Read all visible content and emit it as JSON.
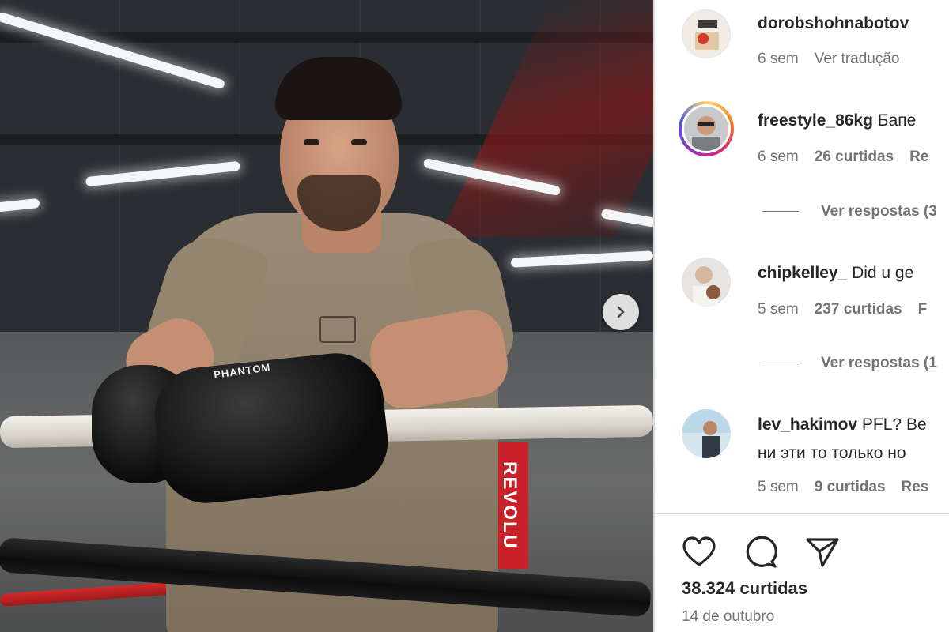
{
  "post": {
    "next_icon": "chevron-right-icon",
    "glove_brand": "PHANTOM",
    "banner_text": "REVOLU"
  },
  "comments": [
    {
      "username": "dorobshohnabotov",
      "text": "",
      "time": "6 sem",
      "likes": "",
      "action": "Ver tradução",
      "replies": ""
    },
    {
      "username": "freestyle_86kg",
      "text": "Бапе",
      "time": "6 sem",
      "likes": "26 curtidas",
      "action": "Re",
      "replies": "Ver respostas (3"
    },
    {
      "username": "chipkelley_",
      "text": "Did u ge",
      "time": "5 sem",
      "likes": "237 curtidas",
      "action": "F",
      "replies": "Ver respostas (1"
    },
    {
      "username": "lev_hakimov",
      "text": "PFL? Be",
      "text2": "ни эти то только но",
      "time": "5 sem",
      "likes": "9 curtidas",
      "action": "Res",
      "replies": ""
    }
  ],
  "actions": {
    "like_icon": "heart-icon",
    "comment_icon": "comment-icon",
    "share_icon": "send-icon"
  },
  "likes_count": "38.324 curtidas",
  "date": "14 de outubro"
}
